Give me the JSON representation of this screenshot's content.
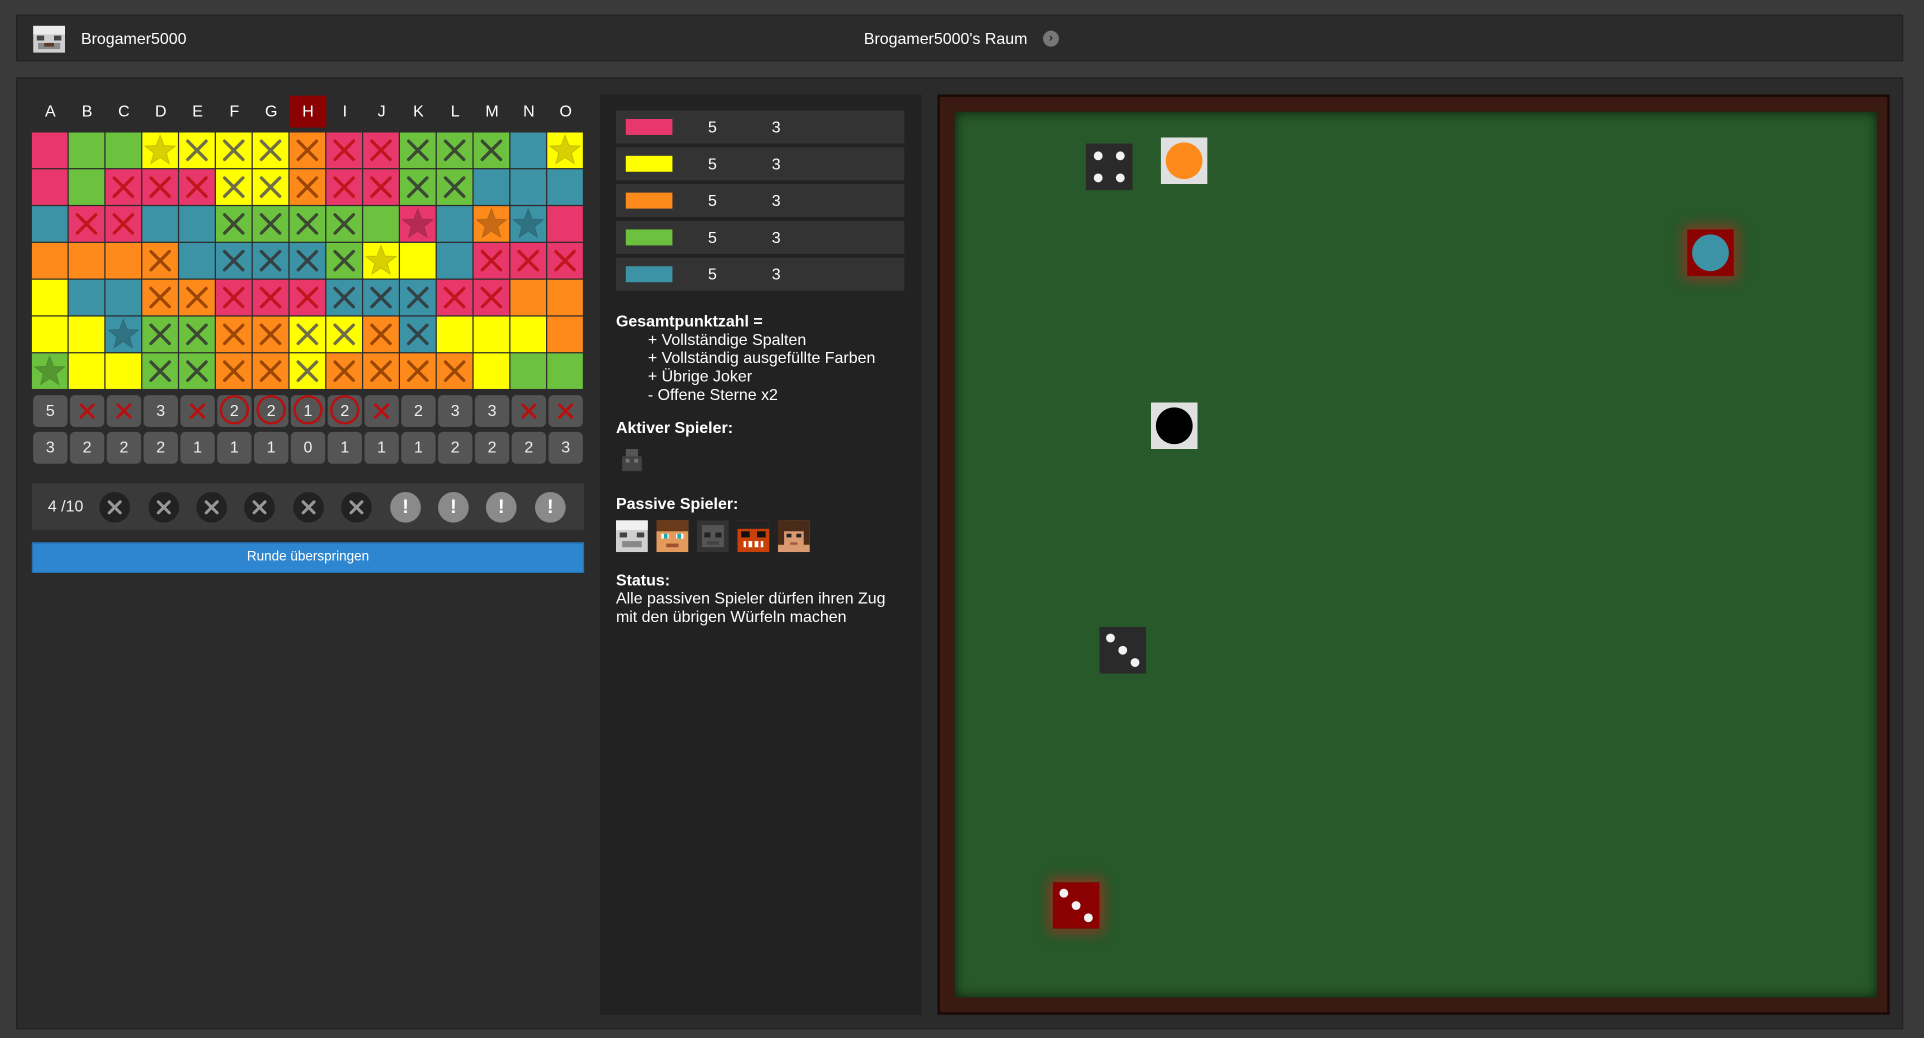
{
  "topbar": {
    "username": "Brogamer5000",
    "room_title": "Brogamer5000's Raum",
    "room_arrow": "›"
  },
  "colors": {
    "pink": "#e8386b",
    "green": "#6cc23e",
    "yellow": "#ffff00",
    "orange": "#ff8a1c",
    "blue": "#3d93a6",
    "mark_red": "#b81010",
    "mark_dark": "#333333",
    "active_col": "#8b0000"
  },
  "board": {
    "columns": [
      "A",
      "B",
      "C",
      "D",
      "E",
      "F",
      "G",
      "H",
      "I",
      "J",
      "K",
      "L",
      "M",
      "N",
      "O"
    ],
    "active_column": "H",
    "grid": [
      [
        "P",
        "G",
        "G",
        "Y",
        "Y",
        "Y",
        "Y",
        "O",
        "P",
        "P",
        "G",
        "G",
        "G",
        "B",
        "Y"
      ],
      [
        "P",
        "G",
        "P",
        "P",
        "P",
        "Y",
        "Y",
        "O",
        "P",
        "P",
        "G",
        "G",
        "B",
        "B",
        "B"
      ],
      [
        "B",
        "P",
        "P",
        "B",
        "B",
        "G",
        "G",
        "G",
        "G",
        "G",
        "P",
        "B",
        "O",
        "B",
        "P"
      ],
      [
        "O",
        "O",
        "O",
        "O",
        "B",
        "B",
        "B",
        "B",
        "G",
        "Y",
        "Y",
        "B",
        "P",
        "P",
        "P"
      ],
      [
        "Y",
        "B",
        "B",
        "O",
        "O",
        "P",
        "P",
        "P",
        "B",
        "B",
        "B",
        "P",
        "P",
        "O",
        "O"
      ],
      [
        "Y",
        "Y",
        "B",
        "G",
        "G",
        "O",
        "O",
        "Y",
        "Y",
        "O",
        "B",
        "Y",
        "Y",
        "Y",
        "O"
      ],
      [
        "G",
        "Y",
        "Y",
        "G",
        "G",
        "O",
        "O",
        "Y",
        "O",
        "O",
        "O",
        "O",
        "Y",
        "G",
        "G"
      ]
    ],
    "crossed": [
      [
        0,
        0,
        0,
        0,
        1,
        1,
        1,
        1,
        1,
        1,
        1,
        1,
        1,
        0,
        0
      ],
      [
        0,
        0,
        1,
        1,
        1,
        1,
        1,
        1,
        1,
        1,
        1,
        1,
        0,
        0,
        0
      ],
      [
        0,
        1,
        1,
        0,
        0,
        1,
        1,
        1,
        1,
        0,
        0,
        0,
        0,
        0,
        0
      ],
      [
        0,
        0,
        0,
        1,
        0,
        1,
        1,
        1,
        1,
        0,
        0,
        0,
        1,
        1,
        1
      ],
      [
        0,
        0,
        0,
        1,
        1,
        1,
        1,
        1,
        1,
        1,
        1,
        1,
        1,
        0,
        0
      ],
      [
        0,
        0,
        0,
        1,
        1,
        1,
        1,
        1,
        1,
        1,
        1,
        0,
        0,
        0,
        0
      ],
      [
        0,
        0,
        0,
        1,
        1,
        1,
        1,
        1,
        1,
        1,
        1,
        1,
        0,
        0,
        0
      ]
    ],
    "stars": [
      [
        0,
        0,
        0,
        1,
        0,
        0,
        0,
        0,
        0,
        0,
        0,
        0,
        0,
        0,
        1
      ],
      [
        0,
        0,
        0,
        0,
        0,
        0,
        0,
        0,
        0,
        0,
        0,
        0,
        0,
        0,
        0
      ],
      [
        0,
        0,
        0,
        0,
        0,
        0,
        0,
        0,
        0,
        0,
        1,
        0,
        1,
        1,
        0
      ],
      [
        0,
        0,
        0,
        0,
        0,
        0,
        0,
        0,
        0,
        1,
        0,
        0,
        0,
        0,
        0
      ],
      [
        0,
        0,
        0,
        0,
        0,
        0,
        0,
        0,
        0,
        0,
        0,
        0,
        0,
        0,
        0
      ],
      [
        0,
        0,
        1,
        0,
        0,
        0,
        0,
        0,
        0,
        0,
        0,
        0,
        0,
        0,
        0
      ],
      [
        1,
        0,
        0,
        0,
        0,
        0,
        0,
        0,
        0,
        0,
        0,
        0,
        0,
        0,
        0
      ]
    ],
    "column_points_first": [
      "5",
      "",
      "",
      "3",
      "",
      "2",
      "2",
      "1",
      "2",
      "",
      "2",
      "3",
      "3",
      "",
      ""
    ],
    "column_points_first_state": [
      "plain",
      "x",
      "x",
      "plain",
      "x",
      "ring",
      "ring",
      "ring",
      "ring",
      "x",
      "plain",
      "plain",
      "plain",
      "x",
      "x"
    ],
    "column_points_second": [
      "3",
      "2",
      "2",
      "2",
      "1",
      "1",
      "1",
      "0",
      "1",
      "1",
      "1",
      "2",
      "2",
      "2",
      "3"
    ]
  },
  "jokers": {
    "label": "4 /10",
    "used": 6,
    "remaining": 4,
    "remaining_symbol": "!"
  },
  "skip_button": "Runde überspringen",
  "color_scores": [
    {
      "color": "#e8386b",
      "a": "5",
      "b": "3"
    },
    {
      "color": "#ffff00",
      "a": "5",
      "b": "3"
    },
    {
      "color": "#ff8a1c",
      "a": "5",
      "b": "3"
    },
    {
      "color": "#6cc23e",
      "a": "5",
      "b": "3"
    },
    {
      "color": "#3d93a6",
      "a": "5",
      "b": "3"
    }
  ],
  "scoring": {
    "title": "Gesamtpunktzahl =",
    "lines": [
      "+ Vollständige Spalten",
      "+ Vollständig ausgefüllte Farben",
      "+ Übrige Joker",
      "- Offene Sterne x2"
    ]
  },
  "active_player_label": "Aktiver Spieler:",
  "passive_players_label": "Passive Spieler:",
  "status": {
    "label": "Status:",
    "text_line1": "Alle passiven Spieler dürfen ihren Zug",
    "text_line2": "mit den übrigen Würfeln machen"
  },
  "dice": [
    {
      "name": "die-dark-four",
      "kind": "number",
      "value": 4,
      "bg": "#2a2a2a"
    },
    {
      "name": "die-orange-color",
      "kind": "color",
      "color": "#ff8a1c",
      "bg": "#e0e0e0"
    },
    {
      "name": "die-blue-color",
      "kind": "color",
      "color": "#3d93a6",
      "bg": "#8b0000"
    },
    {
      "name": "die-black-joker",
      "kind": "color",
      "color": "#000000",
      "bg": "#e0e0e0"
    },
    {
      "name": "die-dark-three",
      "kind": "number",
      "value": 3,
      "bg": "#2a2a2a"
    },
    {
      "name": "die-red-three",
      "kind": "number",
      "value": 3,
      "bg": "#8b0000"
    }
  ]
}
